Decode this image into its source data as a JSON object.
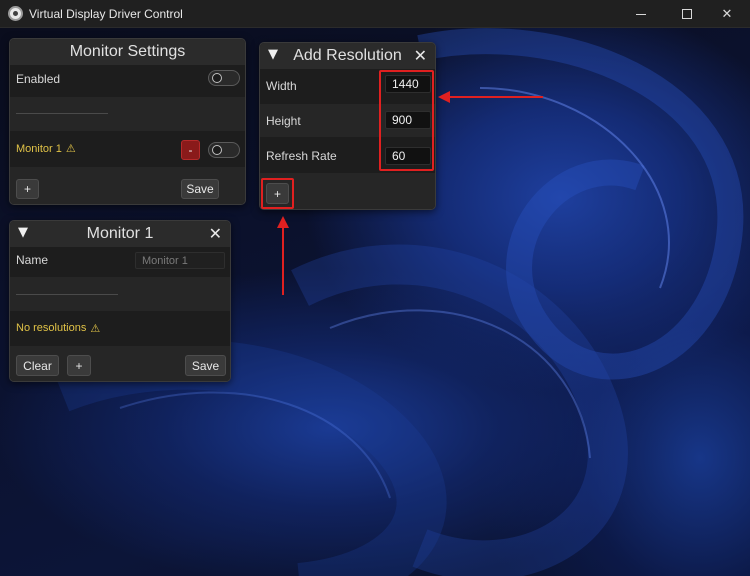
{
  "window": {
    "title": "Virtual Display Driver Control",
    "minimize_icon": "minimize-icon",
    "maximize_icon": "maximize-icon",
    "close_icon": "close-icon",
    "close_glyph": "✕"
  },
  "monitor_settings": {
    "title": "Monitor Settings",
    "enabled_label": "Enabled",
    "enabled_toggle": false,
    "monitor_label": "Monitor 1",
    "warning_glyph": "⚠",
    "remove_label": "-",
    "monitor_toggle": false,
    "add_label": "+",
    "save_label": "Save"
  },
  "monitor_1": {
    "title": "Monitor 1",
    "collapse_glyph": "▼",
    "close_glyph": "✕",
    "name_label": "Name",
    "name_placeholder": "Monitor 1",
    "no_resolutions_label": "No resolutions",
    "warning_glyph": "⚠",
    "clear_label": "Clear",
    "add_label": "+",
    "save_label": "Save"
  },
  "add_resolution": {
    "title": "Add Resolution",
    "collapse_glyph": "▼",
    "close_glyph": "✕",
    "width_label": "Width",
    "width_value": "1440",
    "height_label": "Height",
    "height_value": "900",
    "refresh_label": "Refresh Rate",
    "refresh_value": "60",
    "add_label": "+"
  },
  "colors": {
    "annotation_red": "#e02020",
    "warning_yellow": "#e0c247",
    "remove_button_red": "#8a1a1a"
  }
}
